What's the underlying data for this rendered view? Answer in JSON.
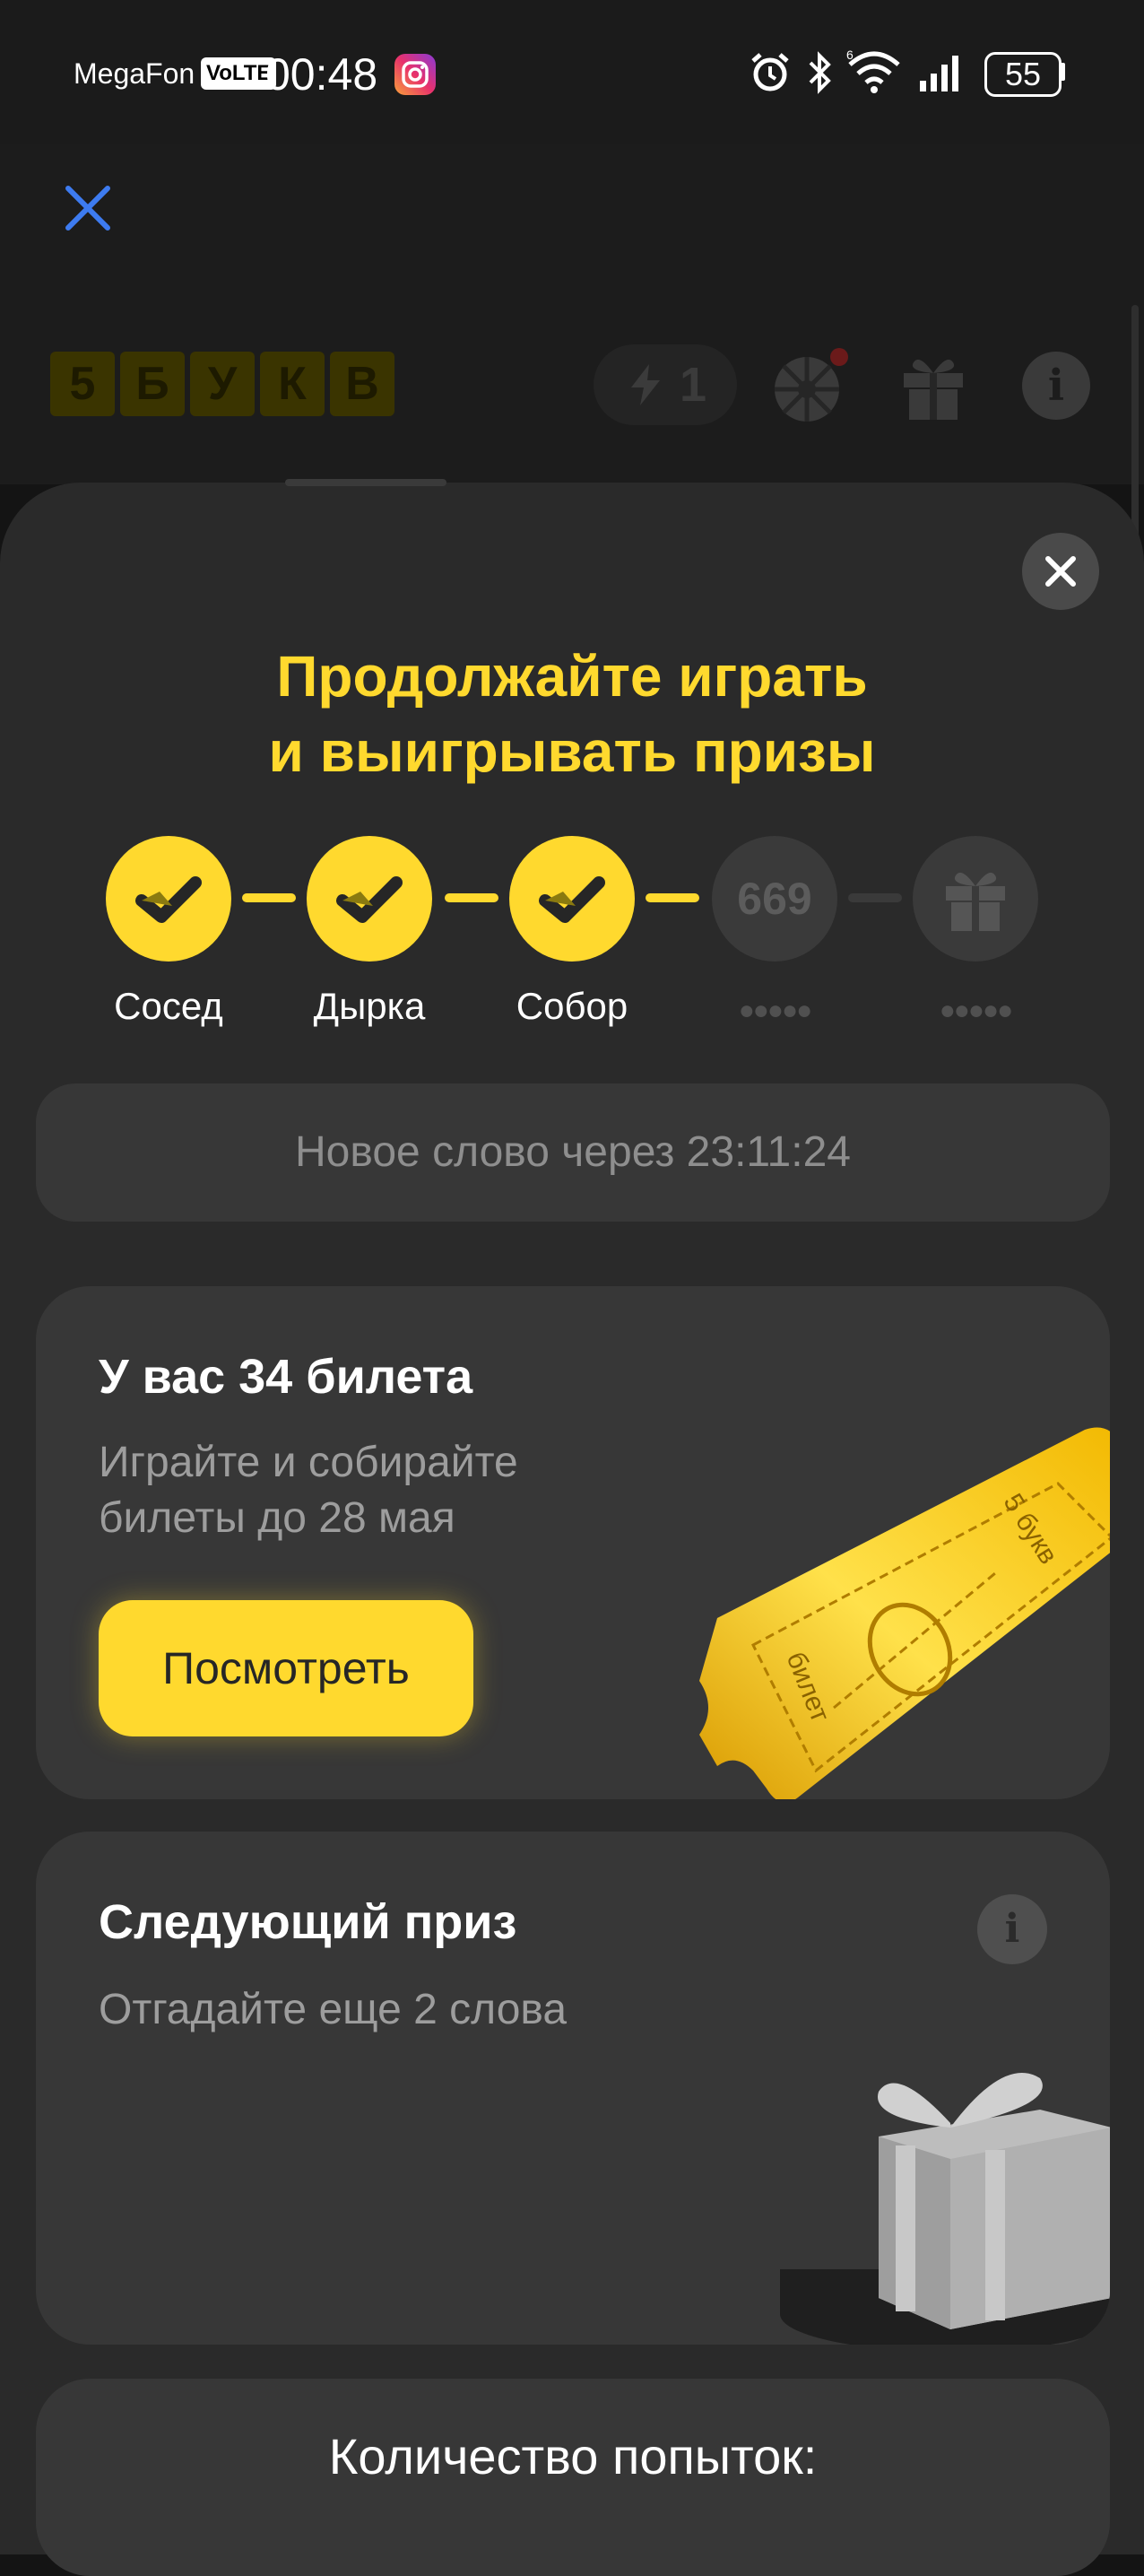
{
  "status_bar": {
    "carrier": "MegaFon",
    "volte": "VoLTE",
    "time": "00:48",
    "battery": "55",
    "icons": [
      "instagram-icon",
      "alarm-icon",
      "bluetooth-icon",
      "wifi-icon",
      "signal-icon",
      "battery-icon"
    ]
  },
  "game_header": {
    "logo_letters": [
      "5",
      "Б",
      "У",
      "К",
      "В"
    ],
    "energy_count": "1",
    "icons": [
      "bolt-icon",
      "wheel-icon",
      "gift-icon",
      "info-icon"
    ]
  },
  "sheet": {
    "headline_line1": "Продолжайте играть",
    "headline_line2": "и выигрывать призы",
    "steps": [
      {
        "label": "Сосед",
        "state": "done"
      },
      {
        "label": "Дырка",
        "state": "done"
      },
      {
        "label": "Собор",
        "state": "done"
      },
      {
        "number": "669",
        "label_dots": "●●●●●",
        "state": "upcoming"
      },
      {
        "label_dots": "●●●●●",
        "state": "prize"
      }
    ],
    "timer_text": "Новое слово через 23:11:24",
    "tickets_card": {
      "title": "У вас 34 билета",
      "subtitle_line1": "Играйте и собирайте",
      "subtitle_line2": "билеты до 28 мая",
      "button_label": "Посмотреть",
      "ticket_text_right": "5 букв",
      "ticket_text_left": "билет"
    },
    "prize_card": {
      "title": "Следующий приз",
      "subtitle": "Отгадайте еще 2 слова",
      "info_label": "i"
    },
    "attempts_card": {
      "title": "Количество попыток:"
    }
  },
  "colors": {
    "accent_yellow": "#ffd92e",
    "card_bg": "#373737",
    "sheet_bg": "#2a2a2a",
    "close_x_blue": "#3d7bf0"
  }
}
